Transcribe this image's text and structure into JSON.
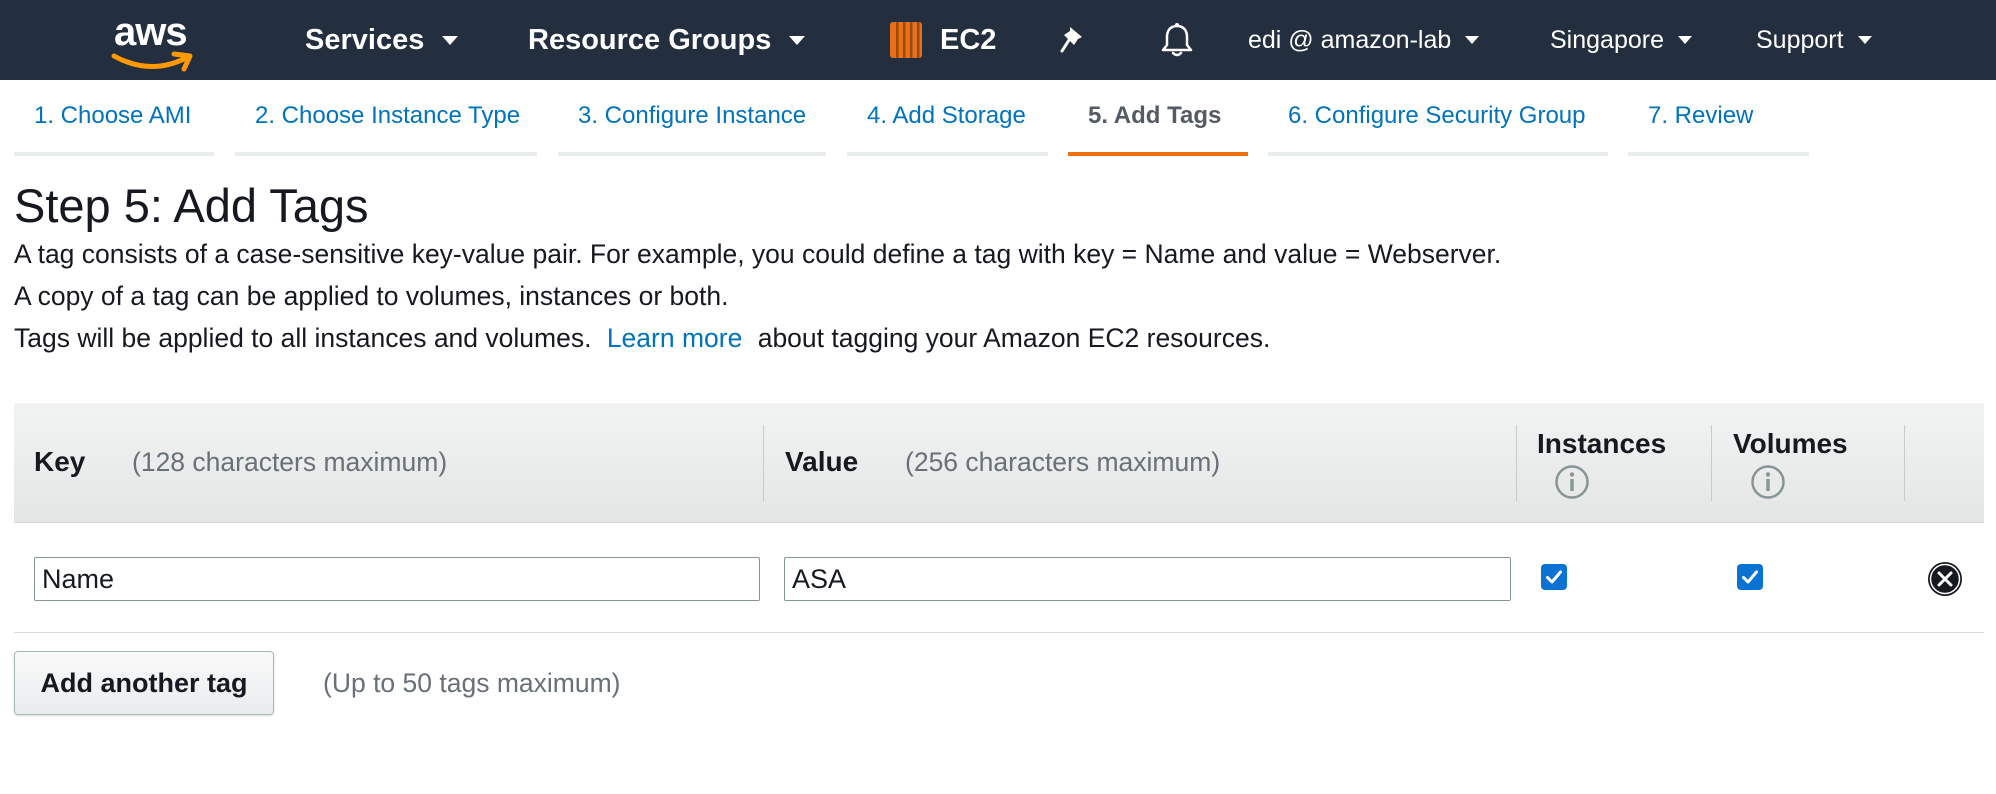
{
  "topbar": {
    "logo_text": "aws",
    "services": "Services",
    "resource_groups": "Resource Groups",
    "service_name": "EC2",
    "account": "edi @ amazon-lab",
    "region": "Singapore",
    "support": "Support",
    "background_color": "#232f3e",
    "logo_smile_color": "#ff9900",
    "ec2_icon_color": "#e7711b"
  },
  "wizard": {
    "steps": [
      {
        "label": "1. Choose AMI"
      },
      {
        "label": "2. Choose Instance Type"
      },
      {
        "label": "3. Configure Instance"
      },
      {
        "label": "4. Add Storage"
      },
      {
        "label": "5. Add Tags"
      },
      {
        "label": "6. Configure Security Group"
      },
      {
        "label": "7. Review"
      }
    ],
    "active_step": 5,
    "active_color": "#ec7211",
    "link_color": "#0073bb"
  },
  "page": {
    "title": "Step 5: Add Tags",
    "desc1": "A tag consists of a case-sensitive key-value pair. For example, you could define a tag with key = Name and value = Webserver.",
    "desc2": "A copy of a tag can be applied to volumes, instances or both.",
    "desc3_before": "Tags will be applied to all instances and volumes.",
    "desc3_link": "Learn more",
    "desc3_after": "about tagging your Amazon EC2 resources."
  },
  "table": {
    "columns": {
      "key_label": "Key",
      "key_hint": "(128 characters maximum)",
      "value_label": "Value",
      "value_hint": "(256 characters maximum)",
      "instances_label": "Instances",
      "volumes_label": "Volumes"
    },
    "rows": [
      {
        "key": "Name",
        "value": "ASA",
        "instances_checked": true,
        "volumes_checked": true
      }
    ]
  },
  "actions": {
    "add_tag_label": "Add another tag",
    "add_tag_hint": "(Up to 50 tags maximum)"
  }
}
